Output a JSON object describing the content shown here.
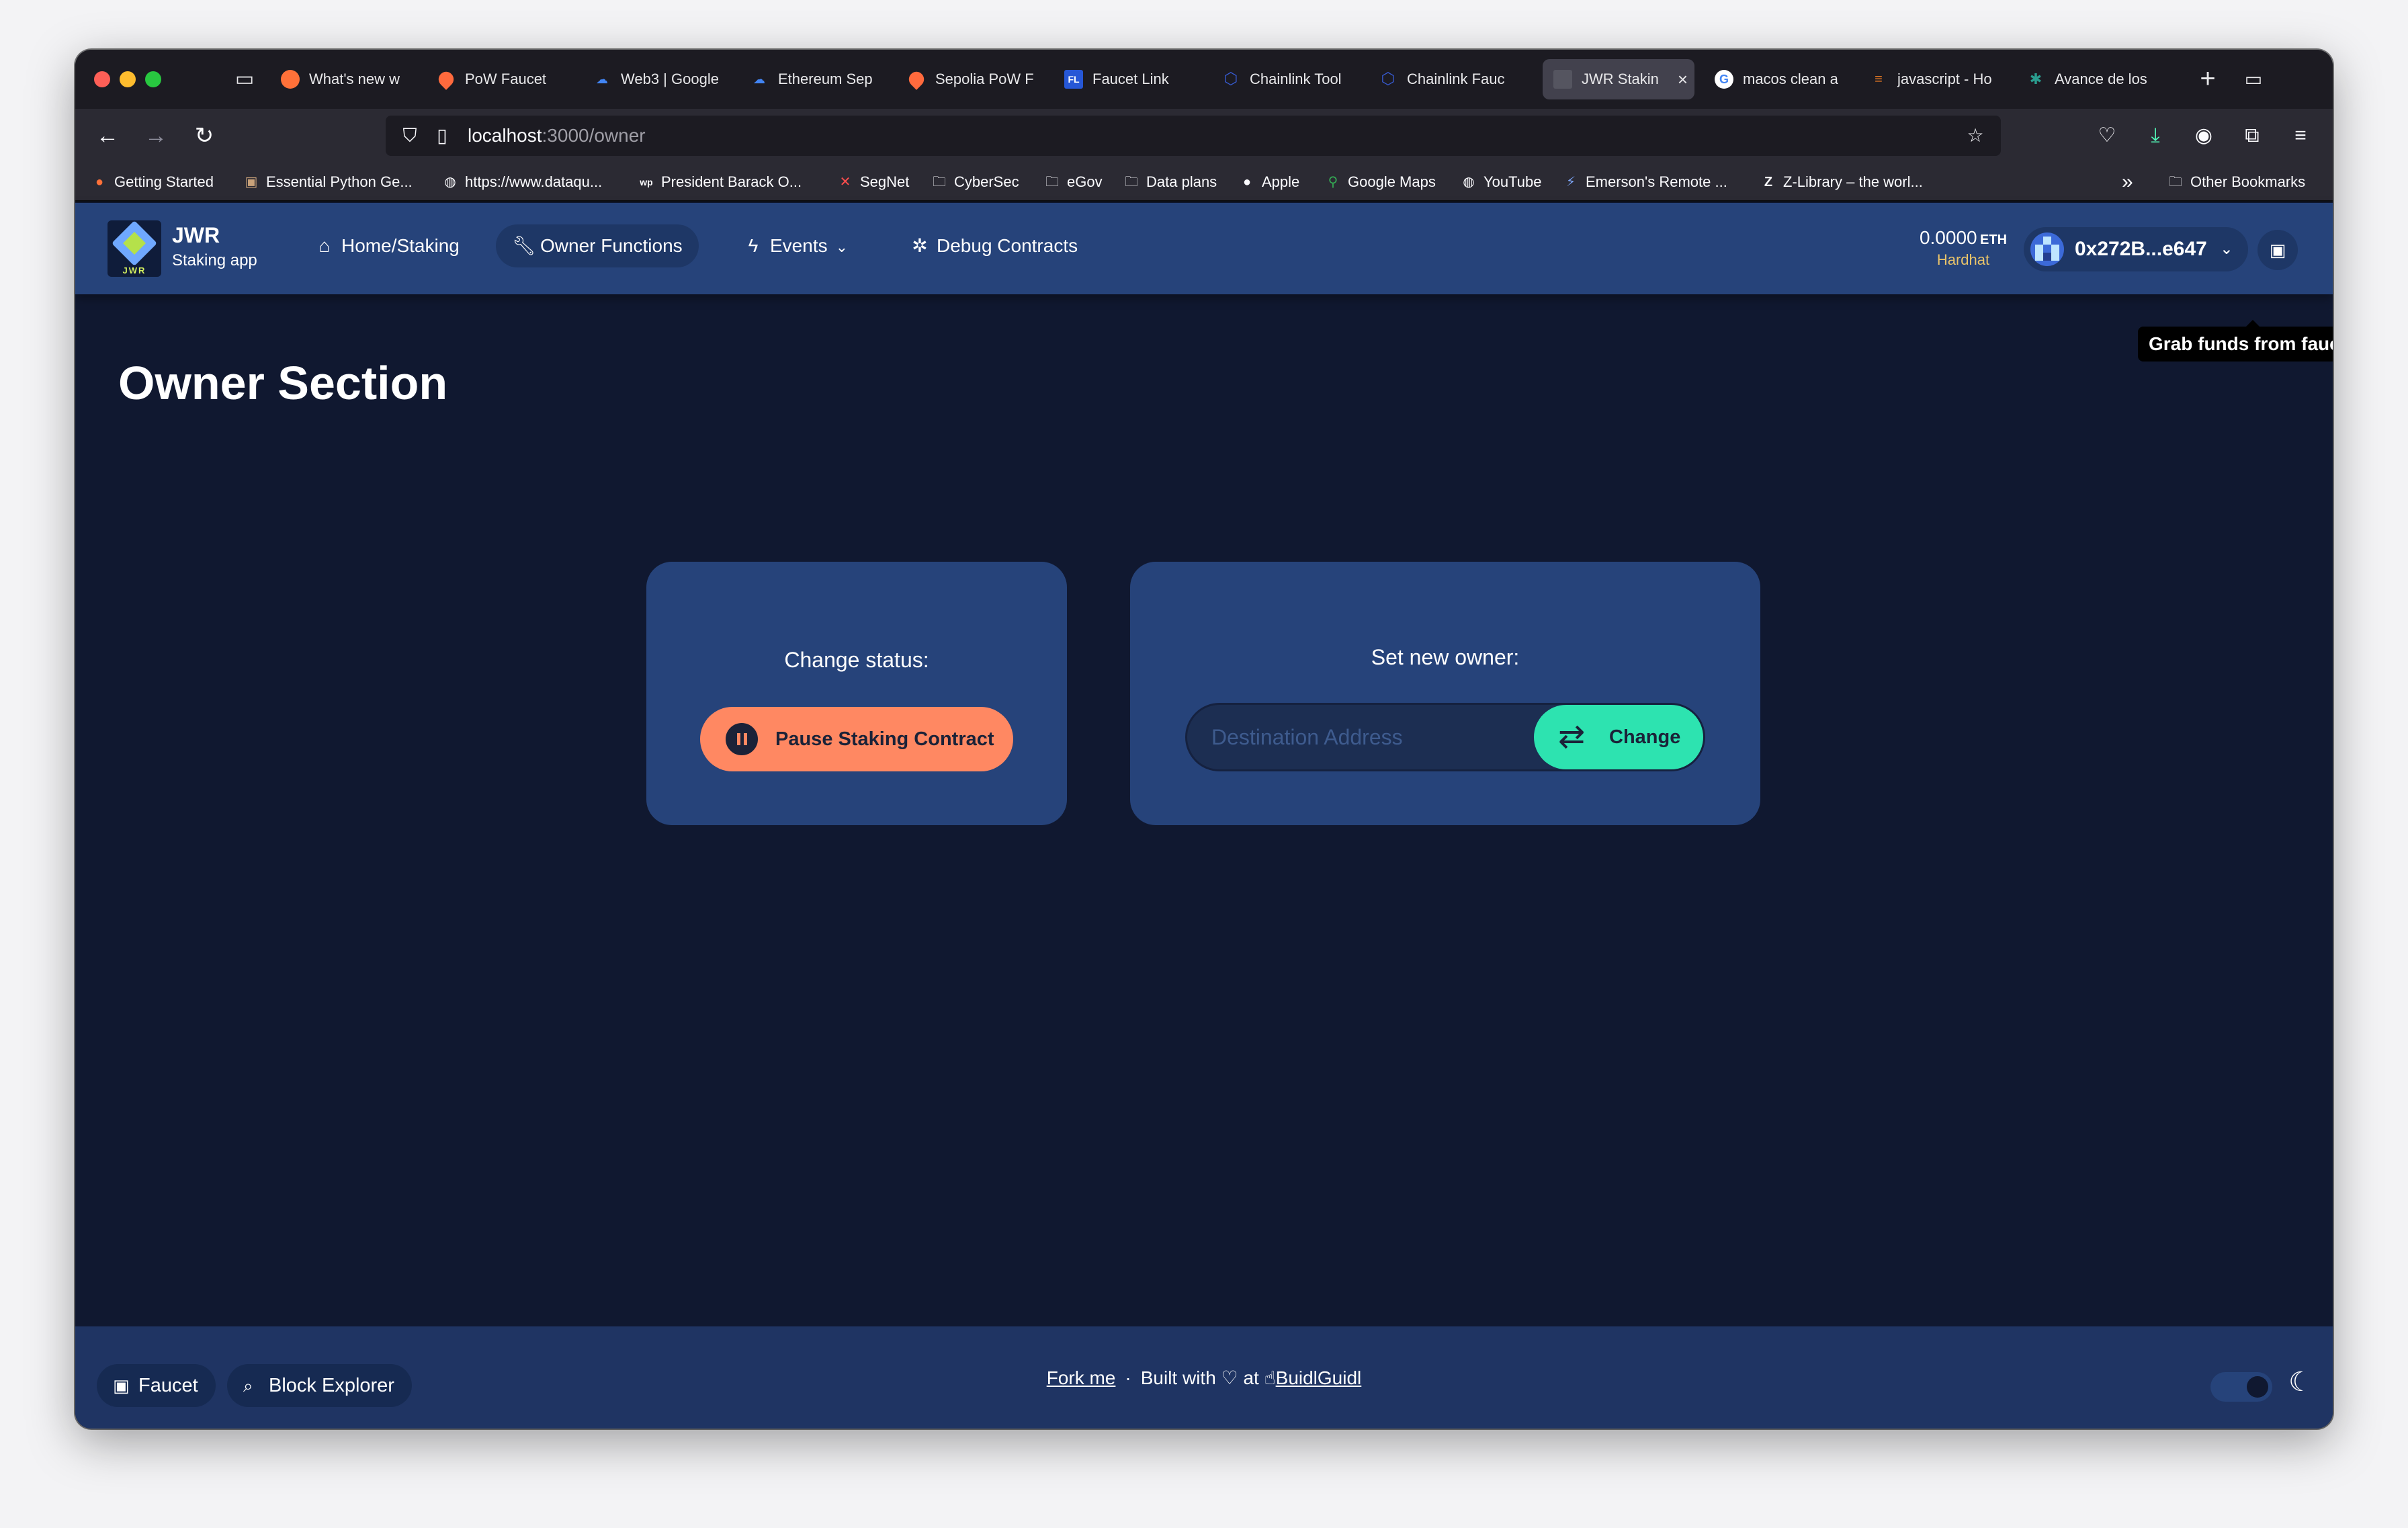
{
  "browser": {
    "tabs": [
      {
        "label": "What's new w",
        "favicon": "firefox-icon",
        "fav_color": "#ff7139",
        "fav_char": "●"
      },
      {
        "label": "PoW Faucet",
        "favicon": "droplet-icon",
        "fav_color": "#ff6a3d",
        "fav_char": "●"
      },
      {
        "label": "Web3 | Google",
        "favicon": "google-cloud-icon",
        "fav_color": "#4285f4",
        "fav_char": "☁"
      },
      {
        "label": "Ethereum Sep",
        "favicon": "google-cloud-icon",
        "fav_color": "#4285f4",
        "fav_char": "☁"
      },
      {
        "label": "Sepolia PoW F",
        "favicon": "droplet-icon",
        "fav_color": "#ff6a3d",
        "fav_char": "●"
      },
      {
        "label": "Faucet Link",
        "favicon": "fl-icon",
        "fav_color": "#2657d6",
        "fav_char": "FL"
      },
      {
        "label": "Chainlink Tool",
        "favicon": "chainlink-icon",
        "fav_color": "#375bd2",
        "fav_char": "⬡"
      },
      {
        "label": "Chainlink Fauc",
        "favicon": "chainlink-icon",
        "fav_color": "#375bd2",
        "fav_char": "⬡"
      },
      {
        "label": "JWR Stakin",
        "favicon": "scaffold-icon",
        "fav_color": "#555560",
        "fav_char": "▣",
        "active": true
      },
      {
        "label": "macos clean a",
        "favicon": "google-icon",
        "fav_color": "#ffffff",
        "fav_char": "G"
      },
      {
        "label": "javascript - Ho",
        "favicon": "stackoverflow-icon",
        "fav_color": "#f48024",
        "fav_char": "≡"
      },
      {
        "label": "Avance de los",
        "favicon": "generic-site-icon",
        "fav_color": "#2a9d8f",
        "fav_char": "✱"
      }
    ],
    "url_host": "localhost",
    "url_path": ":3000/owner",
    "bookmarks": [
      {
        "label": "Getting Started",
        "icon": "firefox-icon"
      },
      {
        "label": "Essential Python Ge...",
        "icon": "portrait-icon"
      },
      {
        "label": "https://www.dataqu...",
        "icon": "globe-icon"
      },
      {
        "label": "President Barack O...",
        "icon": "wp-icon"
      },
      {
        "label": "SegNet",
        "icon": "segnet-icon"
      },
      {
        "label": "CyberSec",
        "icon": "folder-icon"
      },
      {
        "label": "eGov",
        "icon": "folder-icon"
      },
      {
        "label": "Data plans",
        "icon": "folder-icon"
      },
      {
        "label": "Apple",
        "icon": "apple-icon"
      },
      {
        "label": "Google Maps",
        "icon": "map-pin-icon"
      },
      {
        "label": "YouTube",
        "icon": "globe-icon"
      },
      {
        "label": "Emerson's Remote ...",
        "icon": "bolt-icon"
      },
      {
        "label": "Z-Library – the worl...",
        "icon": "zlib-icon"
      }
    ],
    "other_bookmarks": "Other Bookmarks"
  },
  "app": {
    "brand_name": "JWR",
    "brand_sub": "Staking app",
    "logo_text": "JWR",
    "menu": [
      {
        "label": "Home/Staking",
        "icon": "home-icon"
      },
      {
        "label": "Owner Functions",
        "icon": "wrench-icon",
        "active": true
      },
      {
        "label": "Events",
        "icon": "bolt-icon"
      },
      {
        "label": "Debug Contracts",
        "icon": "bug-icon"
      }
    ],
    "balance_amount": "0.0000",
    "balance_unit": "ETH",
    "network": "Hardhat",
    "account": "0x272B...e647",
    "tooltip": "Grab funds from faucet",
    "accent_colors": {
      "header": "#26437a",
      "background": "#101830",
      "pause": "#ff8862",
      "change": "#2de3b0",
      "network": "#e9c46a"
    }
  },
  "page": {
    "title": "Owner Section",
    "status_card": {
      "label": "Change status:",
      "button": "Pause Staking Contract"
    },
    "owner_card": {
      "label": "Set new owner:",
      "placeholder": "Destination Address",
      "button": "Change"
    }
  },
  "footer": {
    "faucet": "Faucet",
    "block_explorer": "Block Explorer",
    "fork_me": "Fork me",
    "separator": "·",
    "built_with": "Built with",
    "at": "at",
    "buidlguidl": "BuidlGuidl"
  }
}
